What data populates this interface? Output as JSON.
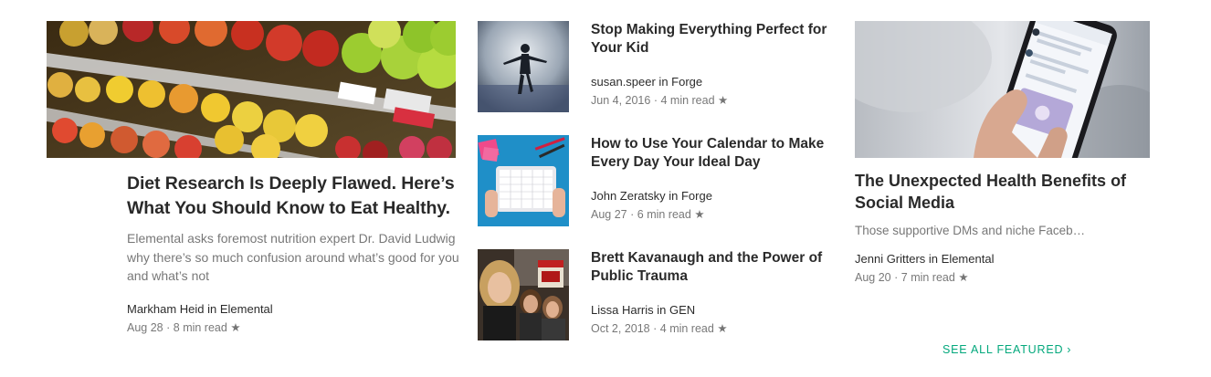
{
  "featured": {
    "lead": {
      "title": "Diet Research Is Deeply Flawed. Here’s What You Should Know to Eat Healthy.",
      "subtitle": "Elemental asks foremost nutrition expert Dr. David Ludwig why there’s so much confusion around what’s good for you and what’s not",
      "author": "Markham Heid in Elemental",
      "date": "Aug 28",
      "read_time": "8 min read",
      "image_icon": "fruit-market-image"
    },
    "middle": [
      {
        "title": "Stop Making Everything Perfect for Your Kid",
        "author": "susan.speer in Forge",
        "date": "Jun 4, 2016",
        "read_time": "4 min read",
        "image_icon": "child-in-mist-image"
      },
      {
        "title": "How to Use Your Calendar to Make Every Day Your Ideal Day",
        "author": "John Zeratsky in Forge",
        "date": "Aug 27",
        "read_time": "6 min read",
        "image_icon": "tablet-calendar-image"
      },
      {
        "title": "Brett Kavanaugh and the Power of Public Trauma",
        "author": "Lissa Harris in GEN",
        "date": "Oct 2, 2018",
        "read_time": "4 min read",
        "image_icon": "protest-crowd-image"
      }
    ],
    "right": {
      "title": "The Unexpected Health Benefits of Social Media",
      "subtitle": "Those supportive DMs and niche Faceb…",
      "author": "Jenni Gritters in Elemental",
      "date": "Aug 20",
      "read_time": "7 min read",
      "image_icon": "phone-in-hand-image"
    }
  },
  "separator_dot": "·",
  "star_glyph": "★",
  "see_all_label": "SEE ALL FEATURED",
  "see_all_chevron": "›",
  "colors": {
    "accent_green": "#03a87c",
    "text_primary": "#000000d6",
    "text_secondary": "#0000008a"
  }
}
